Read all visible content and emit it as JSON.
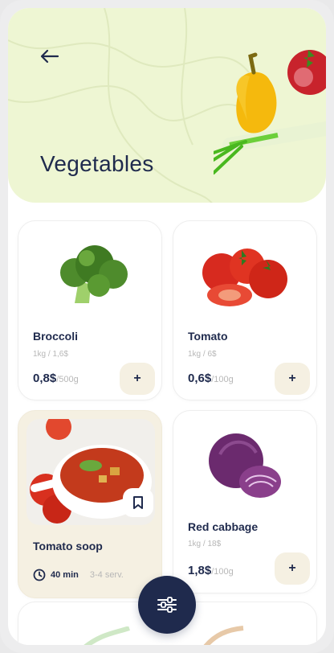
{
  "page": {
    "title": "Vegetables"
  },
  "items": [
    {
      "name": "Broccoli",
      "sub": "1kg / 1,6$",
      "price": "0,8$",
      "unit": "/500g",
      "add_label": "+"
    },
    {
      "name": "Tomato",
      "sub": "1kg / 6$",
      "price": "0,6$",
      "unit": "/100g",
      "add_label": "+"
    },
    {
      "name": "Red cabbage",
      "sub": "1kg / 18$",
      "price": "1,8$",
      "unit": "/100g",
      "add_label": "+"
    }
  ],
  "recipe": {
    "name": "Tomato soop",
    "time": "40 min",
    "servings": "3-4 serv."
  },
  "colors": {
    "primary": "#1f2a4d",
    "hero_bg": "#eef6d3",
    "accent_bg": "#f5f0e2"
  },
  "icons": [
    "back-arrow-icon",
    "plus-icon",
    "clock-icon",
    "bookmark-icon",
    "filter-sliders-icon"
  ]
}
